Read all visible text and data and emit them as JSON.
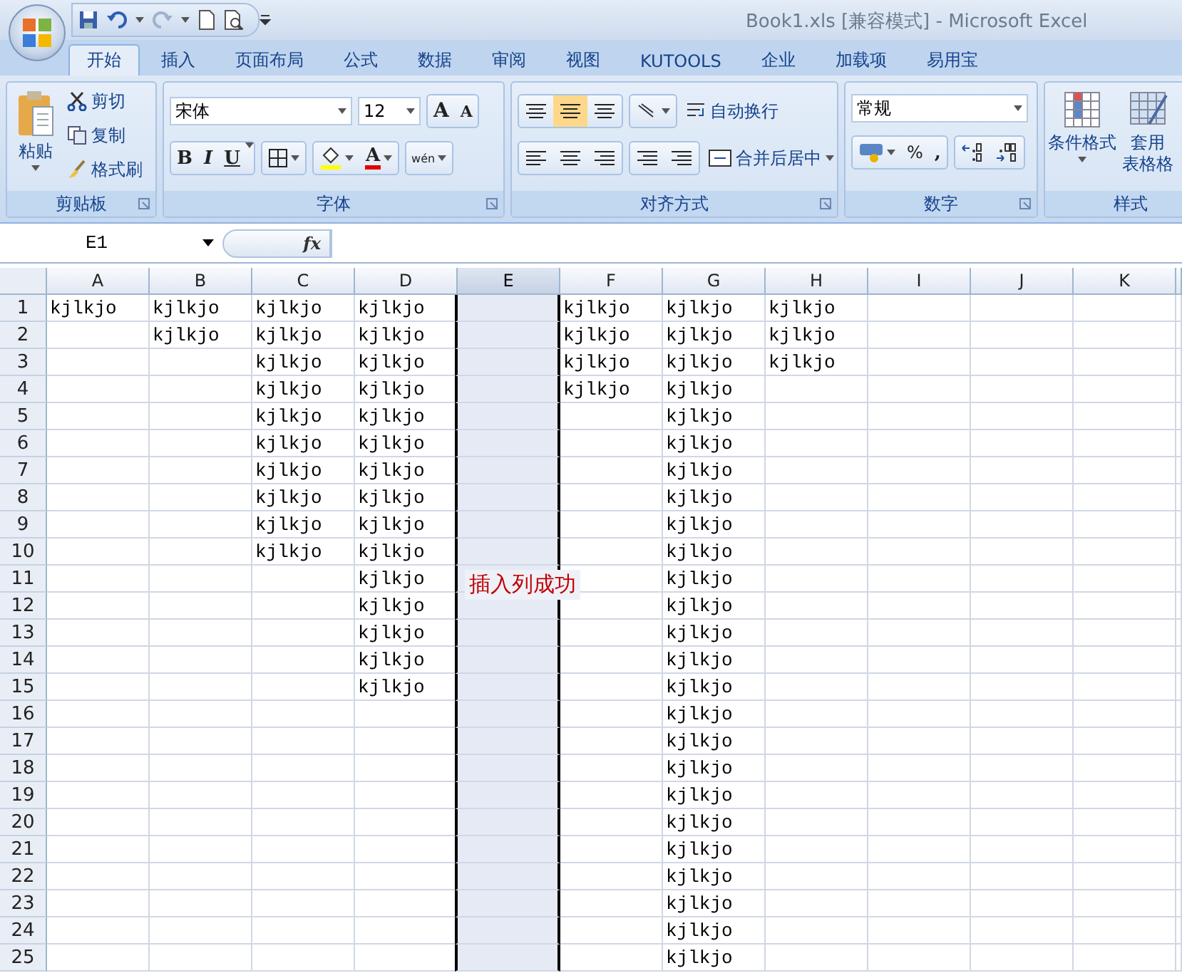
{
  "window": {
    "title": "Book1.xls  [兼容模式] - Microsoft Excel"
  },
  "tabs": [
    {
      "label": "开始",
      "selected": true
    },
    {
      "label": "插入",
      "selected": false
    },
    {
      "label": "页面布局",
      "selected": false
    },
    {
      "label": "公式",
      "selected": false
    },
    {
      "label": "数据",
      "selected": false
    },
    {
      "label": "审阅",
      "selected": false
    },
    {
      "label": "视图",
      "selected": false
    },
    {
      "label": "KUTOOLS",
      "selected": false
    },
    {
      "label": "企业",
      "selected": false
    },
    {
      "label": "加载项",
      "selected": false
    },
    {
      "label": "易用宝",
      "selected": false
    }
  ],
  "ribbon": {
    "clipboard": {
      "title": "剪贴板",
      "paste": "粘贴",
      "cut": "剪切",
      "copy": "复制",
      "format_painter": "格式刷"
    },
    "font": {
      "title": "字体",
      "font_name": "宋体",
      "font_size": "12",
      "grow": "A",
      "shrink": "A",
      "bold": "B",
      "italic": "I",
      "underline": "U",
      "font_color": "A",
      "phonetic": "wén"
    },
    "alignment": {
      "title": "对齐方式",
      "wrap_text": "自动换行",
      "merge_center": "合并后居中",
      "middle_align_selected": true
    },
    "number": {
      "title": "数字",
      "format": "常规",
      "percent": "%",
      "comma": ","
    },
    "styles": {
      "title": "样式",
      "conditional": "条件格式",
      "table_format_line1": "套用",
      "table_format_line2": "表格格"
    }
  },
  "formula_bar": {
    "name_box": "E1",
    "fx_label": "fx"
  },
  "grid": {
    "columns": [
      {
        "label": "A",
        "selected": false
      },
      {
        "label": "B",
        "selected": false
      },
      {
        "label": "C",
        "selected": false
      },
      {
        "label": "D",
        "selected": false
      },
      {
        "label": "E",
        "selected": true
      },
      {
        "label": "F",
        "selected": false
      },
      {
        "label": "G",
        "selected": false
      },
      {
        "label": "H",
        "selected": false
      },
      {
        "label": "I",
        "selected": false
      },
      {
        "label": "J",
        "selected": false
      },
      {
        "label": "K",
        "selected": false
      }
    ],
    "rows": [
      {
        "label": "1",
        "cells": {
          "A": "kjlkjo",
          "B": "kjlkjo",
          "C": "kjlkjo",
          "D": "kjlkjo",
          "F": "kjlkjo",
          "G": "kjlkjo",
          "H": "kjlkjo"
        }
      },
      {
        "label": "2",
        "cells": {
          "B": "kjlkjo",
          "C": "kjlkjo",
          "D": "kjlkjo",
          "F": "kjlkjo",
          "G": "kjlkjo",
          "H": "kjlkjo"
        }
      },
      {
        "label": "3",
        "cells": {
          "C": "kjlkjo",
          "D": "kjlkjo",
          "F": "kjlkjo",
          "G": "kjlkjo",
          "H": "kjlkjo"
        }
      },
      {
        "label": "4",
        "cells": {
          "C": "kjlkjo",
          "D": "kjlkjo",
          "F": "kjlkjo",
          "G": "kjlkjo"
        }
      },
      {
        "label": "5",
        "cells": {
          "C": "kjlkjo",
          "D": "kjlkjo",
          "G": "kjlkjo"
        }
      },
      {
        "label": "6",
        "cells": {
          "C": "kjlkjo",
          "D": "kjlkjo",
          "G": "kjlkjo"
        }
      },
      {
        "label": "7",
        "cells": {
          "C": "kjlkjo",
          "D": "kjlkjo",
          "G": "kjlkjo"
        }
      },
      {
        "label": "8",
        "cells": {
          "C": "kjlkjo",
          "D": "kjlkjo",
          "G": "kjlkjo"
        }
      },
      {
        "label": "9",
        "cells": {
          "C": "kjlkjo",
          "D": "kjlkjo",
          "G": "kjlkjo"
        }
      },
      {
        "label": "10",
        "cells": {
          "C": "kjlkjo",
          "D": "kjlkjo",
          "G": "kjlkjo"
        }
      },
      {
        "label": "11",
        "cells": {
          "D": "kjlkjo",
          "G": "kjlkjo"
        }
      },
      {
        "label": "12",
        "cells": {
          "D": "kjlkjo",
          "G": "kjlkjo"
        }
      },
      {
        "label": "13",
        "cells": {
          "D": "kjlkjo",
          "G": "kjlkjo"
        }
      },
      {
        "label": "14",
        "cells": {
          "D": "kjlkjo",
          "G": "kjlkjo"
        }
      },
      {
        "label": "15",
        "cells": {
          "D": "kjlkjo",
          "G": "kjlkjo"
        }
      },
      {
        "label": "16",
        "cells": {
          "G": "kjlkjo"
        }
      },
      {
        "label": "17",
        "cells": {
          "G": "kjlkjo"
        }
      },
      {
        "label": "18",
        "cells": {
          "G": "kjlkjo"
        }
      },
      {
        "label": "19",
        "cells": {
          "G": "kjlkjo"
        }
      },
      {
        "label": "20",
        "cells": {
          "G": "kjlkjo"
        }
      },
      {
        "label": "21",
        "cells": {
          "G": "kjlkjo"
        }
      },
      {
        "label": "22",
        "cells": {
          "G": "kjlkjo"
        }
      },
      {
        "label": "23",
        "cells": {
          "G": "kjlkjo"
        }
      },
      {
        "label": "24",
        "cells": {
          "G": "kjlkjo"
        }
      },
      {
        "label": "25",
        "cells": {
          "G": "kjlkjo"
        }
      }
    ],
    "annotation": "插入列成功"
  }
}
